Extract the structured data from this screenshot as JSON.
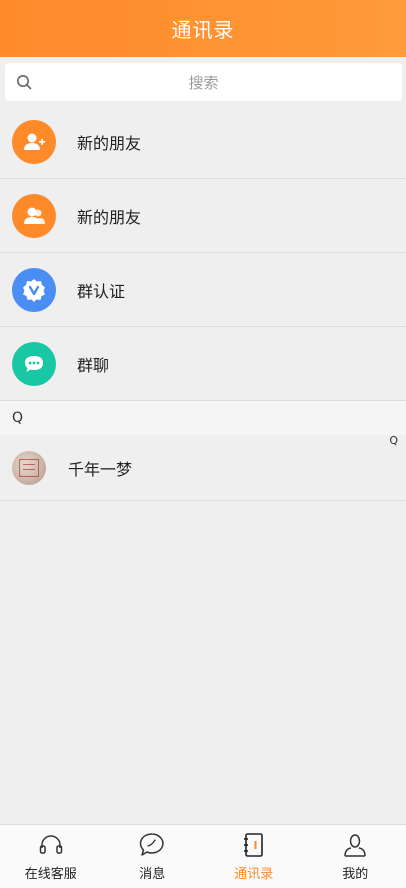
{
  "header": {
    "title": "通讯录"
  },
  "search": {
    "placeholder": "搜索"
  },
  "menu_items": [
    {
      "label": "新的朋友",
      "icon": "add-friend-icon",
      "color": "#ff8a2a"
    },
    {
      "label": "新的朋友",
      "icon": "friends-icon",
      "color": "#ff8a2a"
    },
    {
      "label": "群认证",
      "icon": "verified-badge-icon",
      "color": "#4a8df3"
    },
    {
      "label": "群聊",
      "icon": "group-chat-icon",
      "color": "#1ac7a4"
    }
  ],
  "sections": [
    {
      "letter": "Q",
      "contacts": [
        {
          "name": "千年一梦"
        }
      ]
    }
  ],
  "index_bar": {
    "letter": "Q"
  },
  "tabbar": {
    "items": [
      {
        "label": "在线客服",
        "icon": "headset-icon",
        "active": false
      },
      {
        "label": "消息",
        "icon": "chat-bubble-icon",
        "active": false
      },
      {
        "label": "通讯录",
        "icon": "address-book-icon",
        "active": true
      },
      {
        "label": "我的",
        "icon": "person-icon",
        "active": false
      }
    ]
  },
  "colors": {
    "accent": "#ff8a2a",
    "background": "#efefef"
  }
}
